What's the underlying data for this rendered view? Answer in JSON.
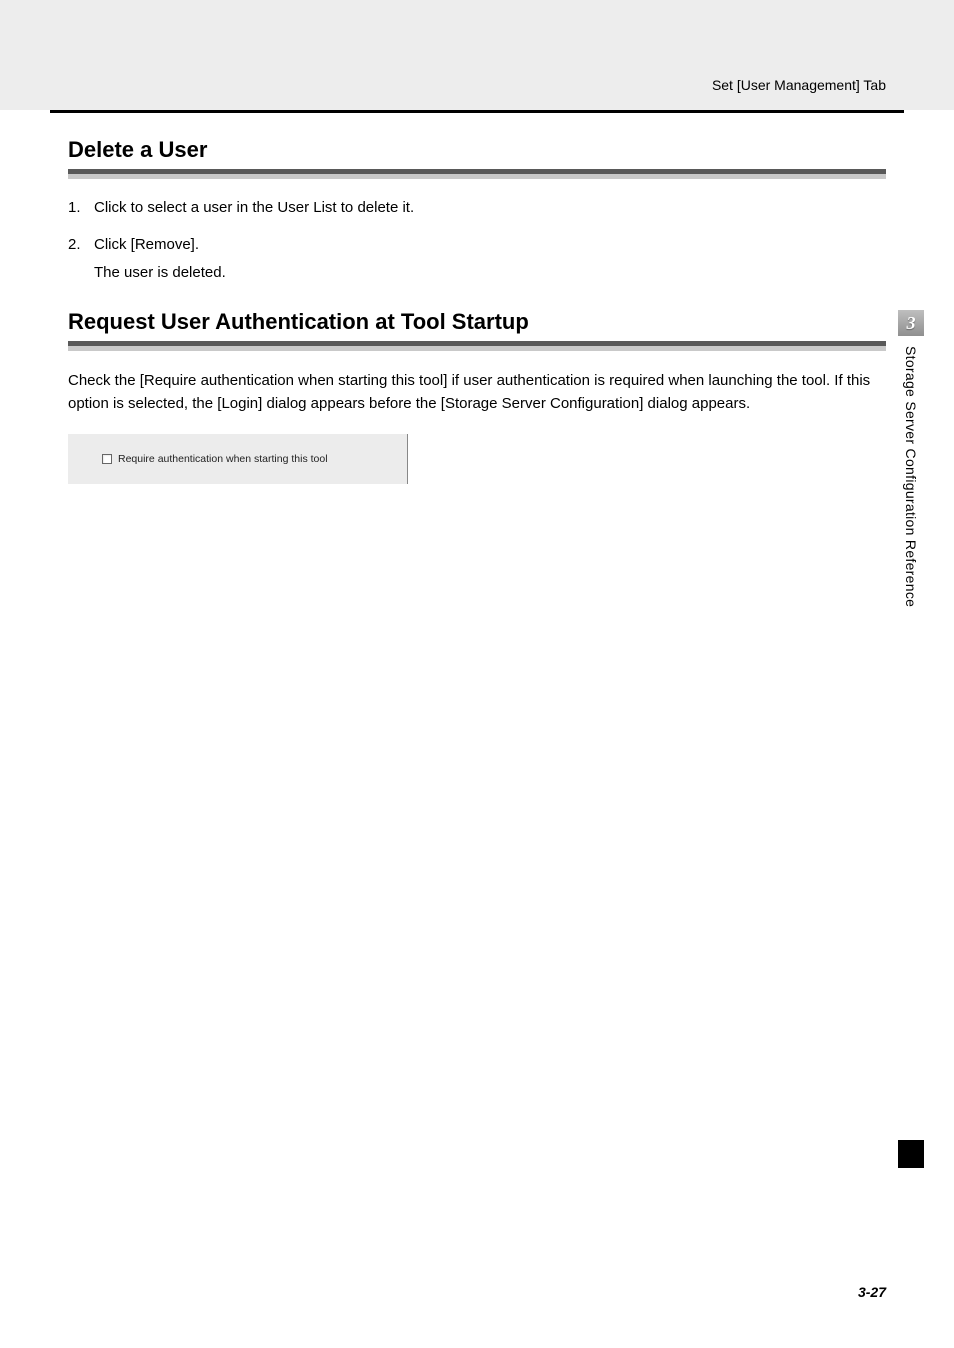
{
  "header": {
    "right_text": "Set [User Management] Tab"
  },
  "sections": {
    "delete_user": {
      "title": "Delete a User",
      "steps": [
        {
          "num": "1.",
          "text": "Click to select a user in the User List to delete it."
        },
        {
          "num": "2.",
          "text": "Click [Remove]."
        }
      ],
      "sub_text": "The user is deleted."
    },
    "request_auth": {
      "title": "Request User Authentication at Tool Startup",
      "paragraph_parts": {
        "p1": "Check the [",
        "b1": "Require authentication when starting this tool",
        "p2": "] if user authentication is required when launching the tool. If this option is selected, the [",
        "b2": "Login",
        "p3": "] dialog appears before the [",
        "b3": "Storage Server Configuration",
        "p4": "] dialog appears."
      },
      "checkbox_label": "Require authentication when starting this tool"
    }
  },
  "side_tab": {
    "number": "3",
    "text": "Storage Server Configuration Reference"
  },
  "footer": {
    "page_number": "3-27"
  }
}
